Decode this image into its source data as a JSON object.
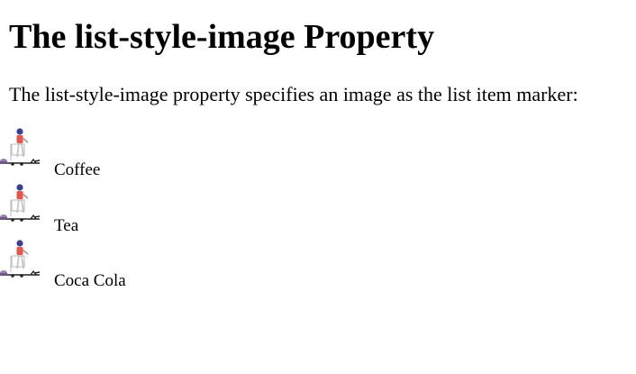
{
  "heading": "The list-style-image Property",
  "description": "The list-style-image property specifies an image as the list item marker:",
  "list": {
    "items": [
      {
        "label": "Coffee",
        "marker_icon": "person-with-shopping-cart-icon"
      },
      {
        "label": "Tea",
        "marker_icon": "person-with-shopping-cart-icon"
      },
      {
        "label": "Coca Cola",
        "marker_icon": "person-with-shopping-cart-icon"
      }
    ]
  },
  "colors": {
    "background": "#ffffff",
    "text": "#000000",
    "marker_shirt": "#e8544a",
    "marker_head": "#3a3f8f",
    "marker_dark": "#222222",
    "marker_wheel": "#9a7fb0"
  }
}
